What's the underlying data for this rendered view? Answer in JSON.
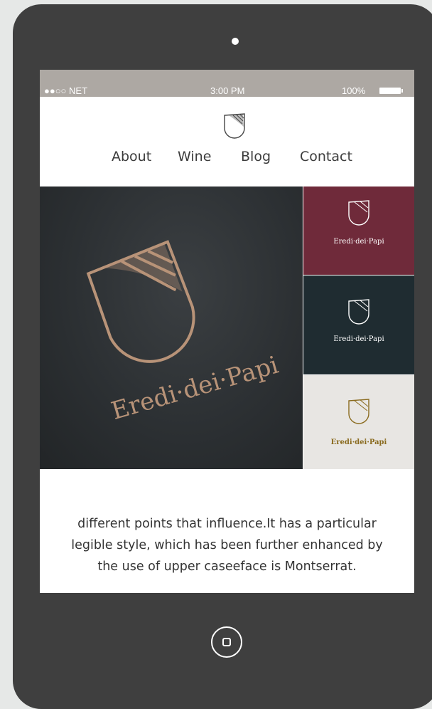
{
  "status_bar": {
    "carrier": "●●○○ NET",
    "time": "3:00 PM",
    "battery": "100%"
  },
  "nav": {
    "items": [
      {
        "label": "About"
      },
      {
        "label": "Wine"
      },
      {
        "label": "Blog"
      },
      {
        "label": "Contact"
      }
    ]
  },
  "hero": {
    "main_brand": "Eredi·dei·Papi",
    "tiles": [
      {
        "brand": "Eredi·dei·Papi",
        "background": "#6f2a3a",
        "foreground": "#ffffff"
      },
      {
        "brand": "Eredi·dei·Papi",
        "background": "#1f2c31",
        "foreground": "#ffffff"
      },
      {
        "brand": "Eredi·dei·Papi",
        "background": "#e8e6e3",
        "foreground": "#8a6b1f"
      }
    ],
    "foil_color": "#b89378"
  },
  "body_text": {
    "lines": [
      "different points that influence.It has a particular",
      "legible style, which has been further enhanced by",
      "the use of upper caseeface is Montserrat."
    ]
  },
  "icons": {
    "logo": "shield-logo-icon",
    "home": "home-button-icon"
  }
}
